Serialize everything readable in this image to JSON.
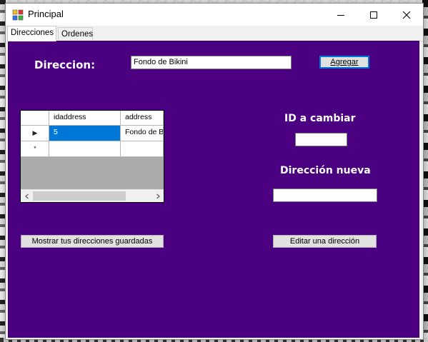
{
  "window": {
    "title": "Principal"
  },
  "tabs": [
    {
      "label": "Direcciones",
      "active": true
    },
    {
      "label": "Ordenes",
      "active": false
    }
  ],
  "form": {
    "direccion_label": "Direccion:",
    "direccion_value": "Fondo de Bikini",
    "agregar_button": "Agregar",
    "id_label": "ID a cambiar",
    "id_value": "",
    "nueva_label": "Dirección nueva",
    "nueva_value": "",
    "mostrar_button": "Mostrar tus direcciones guardadas",
    "editar_button": "Editar una dirección"
  },
  "grid": {
    "columns": [
      "idaddress",
      "address"
    ],
    "rows": [
      {
        "idaddress": "5",
        "address": "Fondo de Bikini",
        "selected": true
      },
      {
        "idaddress": "",
        "address": "",
        "new_row": true
      }
    ],
    "row_marker_current": "▶",
    "row_marker_new": "*"
  },
  "colors": {
    "panel_background": "#4b0082",
    "selection": "#0078d7",
    "label_text": "#ffffff"
  }
}
